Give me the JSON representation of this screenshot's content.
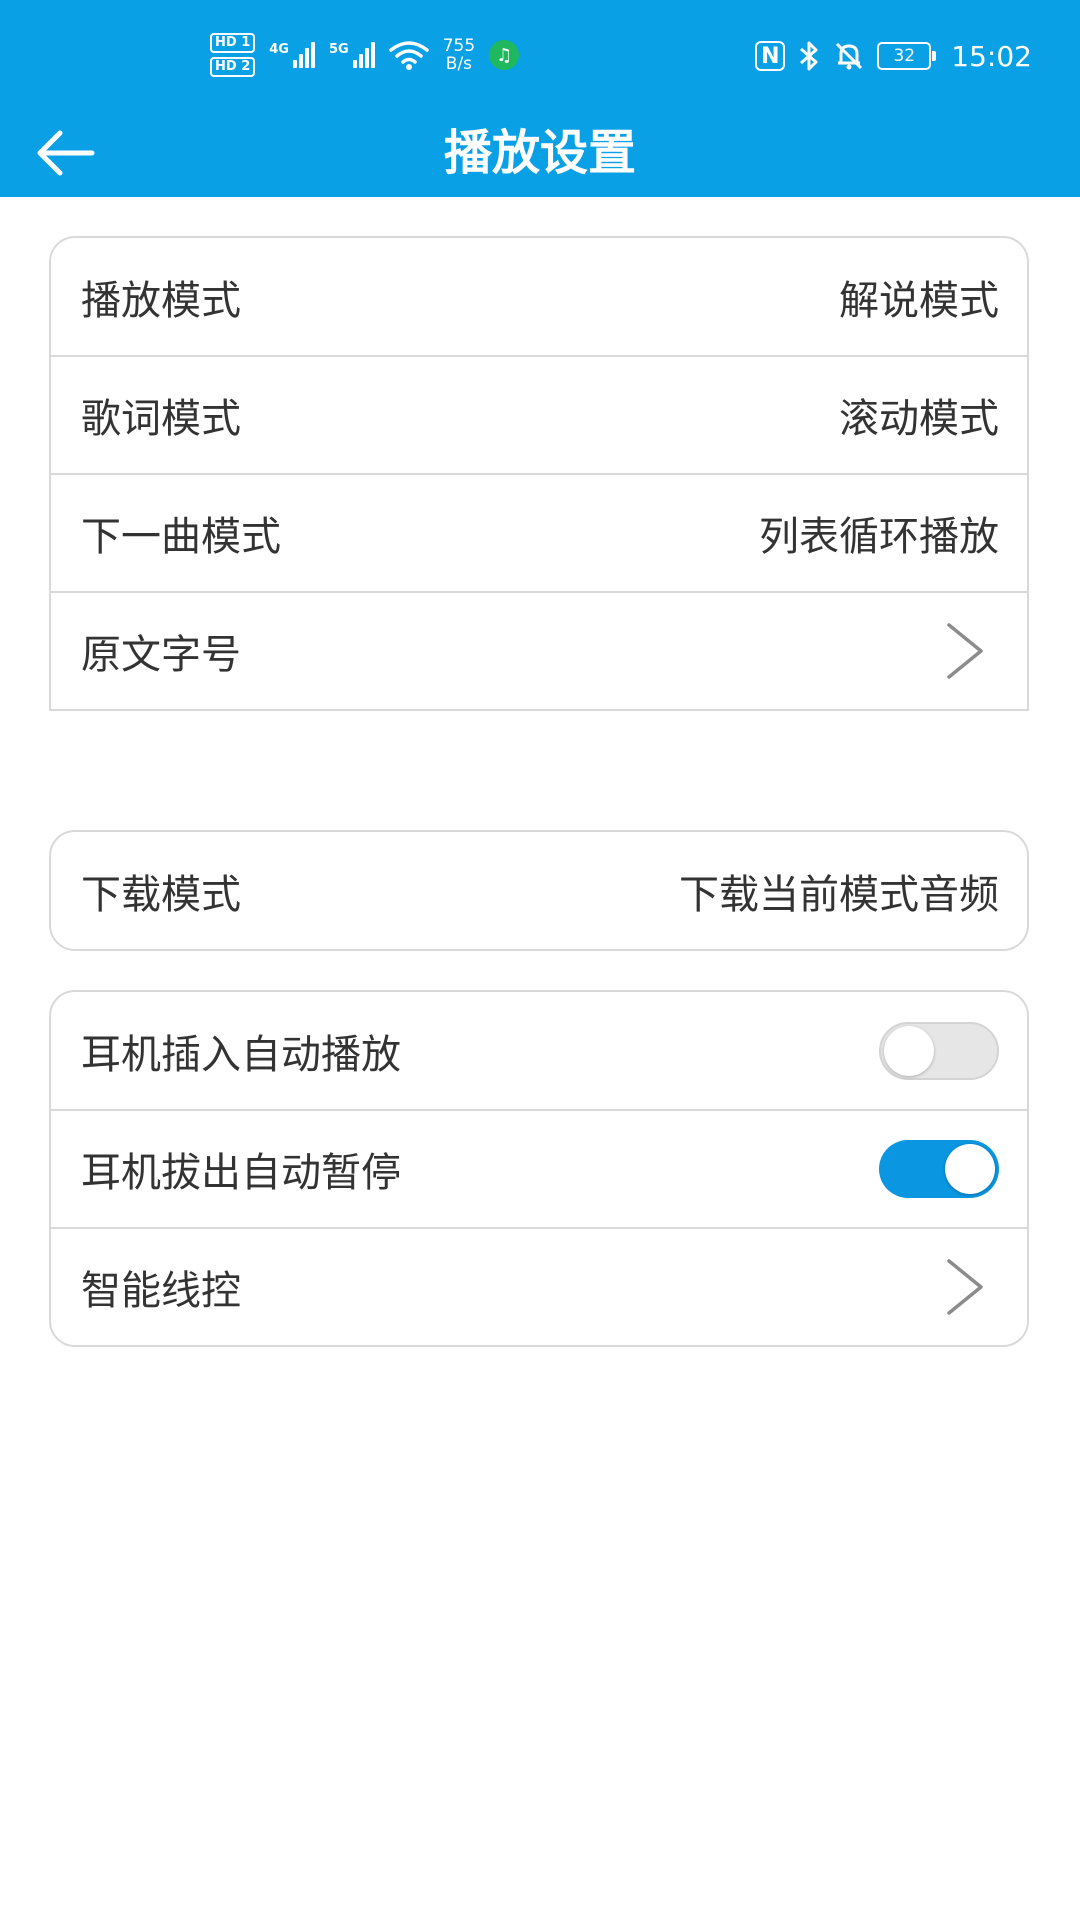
{
  "status_bar": {
    "sim1_badge": "HD 1",
    "sim2_badge": "HD 2",
    "sim1_network": "4G",
    "sim2_network": "5G",
    "net_speed_value": "755",
    "net_speed_unit": "B/s",
    "battery_level": "32",
    "time": "15:02",
    "icons": [
      "nfc-icon",
      "bluetooth-icon",
      "mute-bell-icon",
      "battery-icon",
      "wifi-icon",
      "music-icon"
    ]
  },
  "header": {
    "title": "播放设置",
    "back_icon": "arrow-left-icon"
  },
  "colors": {
    "header_bg": "#0aa0e6",
    "toggle_on": "#0a96e0",
    "toggle_off": "#e6e6e6",
    "divider": "#d9d9d9",
    "text": "#333333"
  },
  "playback_group": {
    "items": [
      {
        "label": "播放模式",
        "value": "解说模式"
      },
      {
        "label": "歌词模式",
        "value": "滚动模式"
      },
      {
        "label": "下一曲模式",
        "value": "列表循环播放"
      },
      {
        "label": "原文字号",
        "value": ""
      }
    ]
  },
  "download_group": {
    "items": [
      {
        "label": "下载模式",
        "value": "下载当前模式音频"
      }
    ]
  },
  "headset_group": {
    "items": [
      {
        "label": "耳机插入自动播放",
        "toggle": "off"
      },
      {
        "label": "耳机拔出自动暂停",
        "toggle": "on"
      },
      {
        "label": "智能线控",
        "value": ""
      }
    ]
  }
}
